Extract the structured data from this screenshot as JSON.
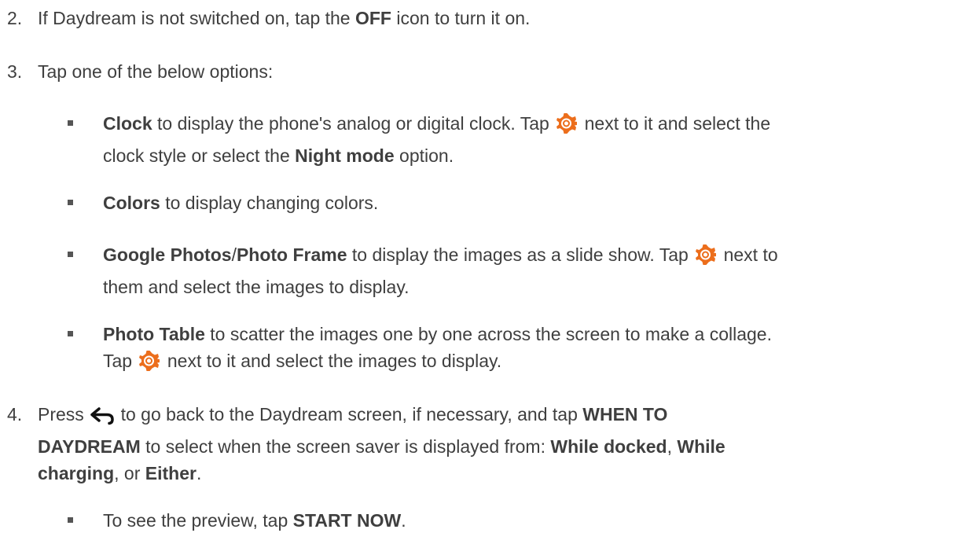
{
  "steps": [
    {
      "num": "2.",
      "a": "If Daydream is not switched on, tap the ",
      "b": "OFF",
      "c": " icon to turn it on."
    },
    {
      "num": "3.",
      "a": "Tap one of the below options:"
    },
    {
      "num": "4.",
      "a": "Press ",
      "b": " to go back to the Daydream screen, if necessary, and tap ",
      "c": "WHEN TO",
      "d": "DAYDREAM",
      "e": " to select when the screen saver is displayed from: ",
      "f": "While docked",
      "g": ", ",
      "h": "While",
      "i": "charging",
      "j": ", or ",
      "k": "Either",
      "l": "."
    }
  ],
  "options": [
    {
      "b1": "Clock",
      "t1": " to display the phone's analog or digital clock. Tap ",
      "t2": " next to it and select the",
      "t3": "clock style or select the ",
      "b2": "Night mode",
      "t4": " option."
    },
    {
      "b1": "Colors",
      "t1": " to display changing colors."
    },
    {
      "b1": "Google Photos",
      "s1": "/",
      "b2": "Photo Frame",
      "t1": " to display the images as a slide show. Tap ",
      "t2": " next to",
      "t3": "them and select the images to display."
    },
    {
      "b1": "Photo Table",
      "t1": " to scatter the images one by one across the screen to make a collage.",
      "t2": "Tap ",
      "t3": " next to it and select the images to display."
    }
  ],
  "sub": {
    "t1": "To see the preview, tap ",
    "b1": "START NOW",
    "t2": "."
  },
  "icons": {
    "settings": "gear-icon",
    "back": "back-arrow-icon"
  }
}
